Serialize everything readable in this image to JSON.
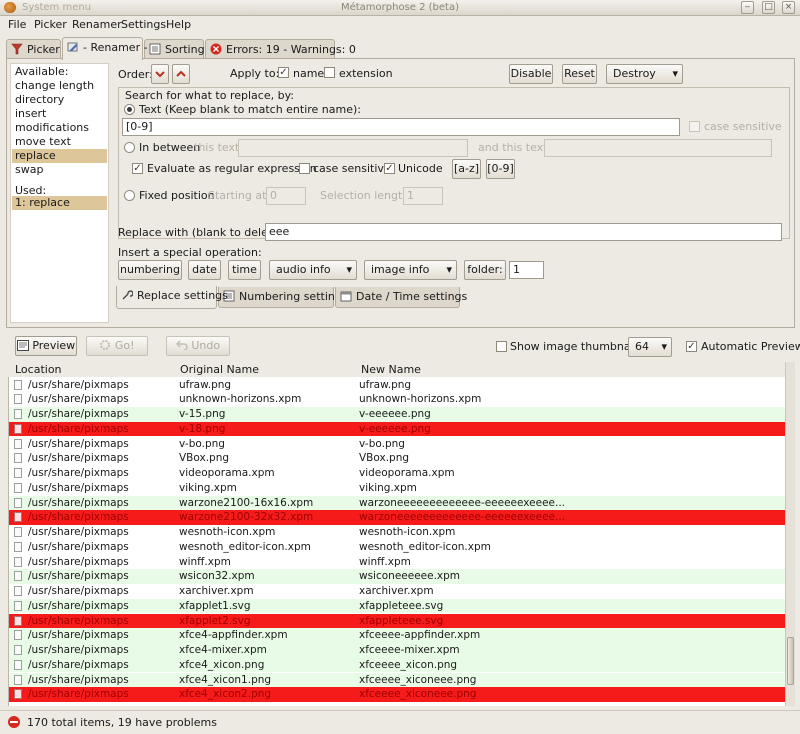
{
  "window": {
    "title": "Métamorphose 2 (beta)",
    "system_menu": "System menu"
  },
  "menu": {
    "file": "File",
    "picker": "Picker",
    "renamer": "Renamer",
    "settings": "Settings",
    "help": "Help"
  },
  "tabs": {
    "picker": "Picker",
    "renamer": "- Renamer -",
    "sorting": "Sorting",
    "errors": "Errors: 19 - Warnings: 0"
  },
  "available": {
    "header": "Available:",
    "items": [
      "change length",
      "directory",
      "insert",
      "modifications",
      "move text",
      "replace",
      "swap"
    ],
    "selected_index": 5
  },
  "used": {
    "header": "Used:",
    "items": [
      "1: replace"
    ]
  },
  "order": {
    "label": "Order:"
  },
  "apply_to": {
    "label": "Apply to:",
    "name": "name",
    "extension": "extension",
    "name_checked": true,
    "extension_checked": false
  },
  "actions": {
    "disable": "Disable",
    "reset": "Reset",
    "destroy": "Destroy"
  },
  "search": {
    "frame_label": "Search for what to replace, by:",
    "text_option": "Text (Keep blank to match entire name):",
    "text_value": "[0-9]",
    "case_sensitive_right": "case sensitive",
    "in_between": "In between",
    "this_text": "this text:",
    "and_this_text": "and this text:",
    "evaluate_regex": "Evaluate as regular expression",
    "case_sensitive": "case sensitive",
    "unicode": "Unicode",
    "regex_az": "[a-z]",
    "regex_09": "[0-9]",
    "fixed_position": "Fixed position",
    "starting_at": "Starting at:",
    "starting_value": "0",
    "selection_length": "Selection length:",
    "selection_value": "1"
  },
  "replace_with": {
    "label": "Replace with (blank to delete):",
    "value": "eee"
  },
  "special": {
    "label": "Insert a special operation:",
    "numbering": "numbering",
    "date": "date",
    "time": "time",
    "audio_info": "audio info",
    "image_info": "image info",
    "folder": "folder:",
    "folder_value": "1"
  },
  "bottom_tabs": {
    "replace": "Replace settings",
    "numbering": "Numbering settings",
    "datetime": "Date / Time settings"
  },
  "toolbar": {
    "preview": "Preview",
    "go": "Go!",
    "undo": "Undo",
    "thumbnails_label": "Show image thumbnails",
    "thumbnails_checked": false,
    "thumb_size": "64",
    "auto_preview": "Automatic Preview",
    "auto_preview_checked": true
  },
  "table": {
    "columns": [
      "Location",
      "Original Name",
      "New Name"
    ],
    "rows": [
      {
        "location": "/usr/share/pixmaps",
        "original": "ufraw.png",
        "new": "ufraw.png",
        "status": "none"
      },
      {
        "location": "/usr/share/pixmaps",
        "original": "unknown-horizons.xpm",
        "new": "unknown-horizons.xpm",
        "status": "none"
      },
      {
        "location": "/usr/share/pixmaps",
        "original": "v-15.png",
        "new": "v-eeeeee.png",
        "status": "ok"
      },
      {
        "location": "/usr/share/pixmaps",
        "original": "v-18.png",
        "new": "v-eeeeee.png",
        "status": "err"
      },
      {
        "location": "/usr/share/pixmaps",
        "original": "v-bo.png",
        "new": "v-bo.png",
        "status": "none"
      },
      {
        "location": "/usr/share/pixmaps",
        "original": "VBox.png",
        "new": "VBox.png",
        "status": "none"
      },
      {
        "location": "/usr/share/pixmaps",
        "original": "videoporama.xpm",
        "new": "videoporama.xpm",
        "status": "none"
      },
      {
        "location": "/usr/share/pixmaps",
        "original": "viking.xpm",
        "new": "viking.xpm",
        "status": "none"
      },
      {
        "location": "/usr/share/pixmaps",
        "original": "warzone2100-16x16.xpm",
        "new": "warzoneeeeeeeeeeeee-eeeeeexeeee...",
        "status": "ok"
      },
      {
        "location": "/usr/share/pixmaps",
        "original": "warzone2100-32x32.xpm",
        "new": "warzoneeeeeeeeeeeee-eeeeeexeeee...",
        "status": "err"
      },
      {
        "location": "/usr/share/pixmaps",
        "original": "wesnoth-icon.xpm",
        "new": "wesnoth-icon.xpm",
        "status": "none"
      },
      {
        "location": "/usr/share/pixmaps",
        "original": "wesnoth_editor-icon.xpm",
        "new": "wesnoth_editor-icon.xpm",
        "status": "none"
      },
      {
        "location": "/usr/share/pixmaps",
        "original": "winff.xpm",
        "new": "winff.xpm",
        "status": "none"
      },
      {
        "location": "/usr/share/pixmaps",
        "original": "wsicon32.xpm",
        "new": "wsiconeeeeee.xpm",
        "status": "ok"
      },
      {
        "location": "/usr/share/pixmaps",
        "original": "xarchiver.xpm",
        "new": "xarchiver.xpm",
        "status": "none"
      },
      {
        "location": "/usr/share/pixmaps",
        "original": "xfapplet1.svg",
        "new": "xfappleteee.svg",
        "status": "ok"
      },
      {
        "location": "/usr/share/pixmaps",
        "original": "xfapplet2.svg",
        "new": "xfappleteee.svg",
        "status": "err"
      },
      {
        "location": "/usr/share/pixmaps",
        "original": "xfce4-appfinder.xpm",
        "new": "xfceeee-appfinder.xpm",
        "status": "ok"
      },
      {
        "location": "/usr/share/pixmaps",
        "original": "xfce4-mixer.xpm",
        "new": "xfceeee-mixer.xpm",
        "status": "ok"
      },
      {
        "location": "/usr/share/pixmaps",
        "original": "xfce4_xicon.png",
        "new": "xfceeee_xicon.png",
        "status": "ok"
      },
      {
        "location": "/usr/share/pixmaps",
        "original": "xfce4_xicon1.png",
        "new": "xfceeee_xiconeee.png",
        "status": "ok"
      },
      {
        "location": "/usr/share/pixmaps",
        "original": "xfce4_xicon2.png",
        "new": "xfceeee_xiconeee.png",
        "status": "err"
      }
    ]
  },
  "status": {
    "text": "170 total items, 19 have problems"
  },
  "colors": {
    "selected": "#dcc69a",
    "ok_row": "#e8fbe6",
    "error_row": "#f51b1b"
  }
}
